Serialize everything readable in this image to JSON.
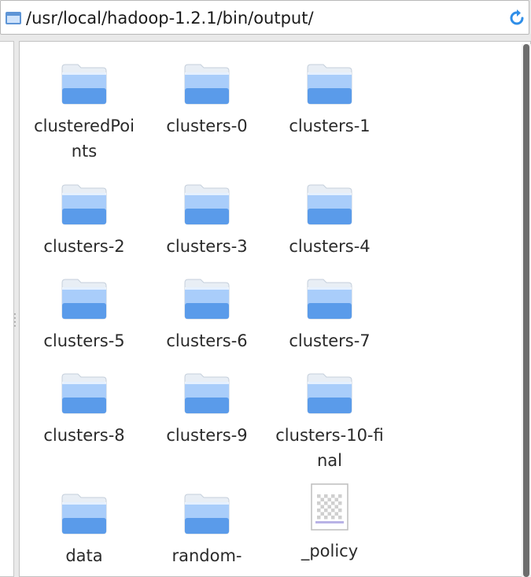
{
  "location": {
    "path": "/usr/local/hadoop-1.2.1/bin/output/"
  },
  "items": [
    {
      "label": "clusteredPoints",
      "type": "folder"
    },
    {
      "label": "clusters-0",
      "type": "folder"
    },
    {
      "label": "clusters-1",
      "type": "folder"
    },
    {
      "label": "clusters-2",
      "type": "folder"
    },
    {
      "label": "clusters-3",
      "type": "folder"
    },
    {
      "label": "clusters-4",
      "type": "folder"
    },
    {
      "label": "clusters-5",
      "type": "folder"
    },
    {
      "label": "clusters-6",
      "type": "folder"
    },
    {
      "label": "clusters-7",
      "type": "folder"
    },
    {
      "label": "clusters-8",
      "type": "folder"
    },
    {
      "label": "clusters-9",
      "type": "folder"
    },
    {
      "label": "clusters-10-final",
      "type": "folder"
    },
    {
      "label": "data",
      "type": "folder"
    },
    {
      "label": "random-",
      "type": "folder"
    },
    {
      "label": "_policy",
      "type": "file"
    }
  ],
  "colors": {
    "folder_light": "#a9cdfa",
    "folder_dark": "#5a9bea",
    "reload": "#2f8ee8"
  },
  "icons": {
    "location": "folder-icon",
    "reload": "reload-icon",
    "file": "file-icon"
  }
}
